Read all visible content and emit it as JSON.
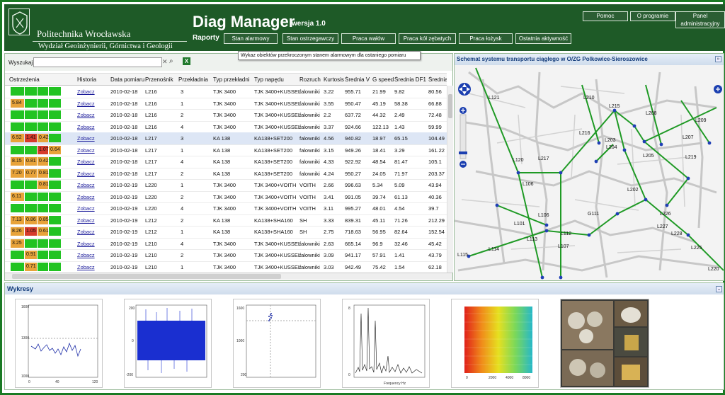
{
  "header": {
    "university": "Politechnika Wrocławska",
    "faculty": "Wydział Geoinżynierii, Górnictwa i Geologii",
    "app_title": "Diag Manager",
    "app_version": "wersja 1.0",
    "reports_label": "Raporty",
    "nav": [
      "Stan alarmowy",
      "Stan ostrzegawczy",
      "Praca wałów",
      "Praca kół zębatych",
      "Praca łożysk",
      "Ostatnia aktywność"
    ],
    "top_buttons": [
      "Pomoc",
      "O programie"
    ],
    "admin_panel": "Panel administracyjny"
  },
  "tooltip": "Wykaz obiektów przekroczonym stanem alarmowym dla ostaniego pomiaru",
  "search": {
    "label": "Wyszukaj",
    "value": "",
    "clear_icon": "✕",
    "search_icon": "⌕",
    "export_icon": "X"
  },
  "table": {
    "columns": [
      "Ostrzeżenia",
      "Historia",
      "Data pomiaru",
      "Przenośnik",
      "Przekładnia",
      "Typ przekładni",
      "Typ napędu",
      "Rozruch",
      "Kurtosis",
      "Średnia V",
      "G speed",
      "Średnia DF1",
      "Średnia DF3"
    ],
    "rows": [
      {
        "w": [
          "",
          "",
          "",
          ""
        ],
        "h": "Zobacz",
        "date": "2010-02-18",
        "p": "L216",
        "g": "3",
        "tp": "TJK 3400",
        "tn": "TJK 3400+KUSSEL",
        "r": "falowniki",
        "k": "3.22",
        "v": "955.71",
        "gs": "21.99",
        "df1": "9.82",
        "df3": "80.56"
      },
      {
        "w": [
          "5.84",
          "",
          "",
          ""
        ],
        "h": "Zobacz",
        "date": "2010-02-18",
        "p": "L216",
        "g": "1",
        "tp": "TJK 3400",
        "tn": "TJK 3400+KUSSEL",
        "r": "falowniki",
        "k": "3.55",
        "v": "950.47",
        "gs": "45.19",
        "df1": "58.38",
        "df3": "66.88"
      },
      {
        "w": [
          "",
          "",
          "",
          ""
        ],
        "h": "Zobacz",
        "date": "2010-02-18",
        "p": "L216",
        "g": "2",
        "tp": "TJK 3400",
        "tn": "TJK 3400+KUSSEL",
        "r": "falowniki",
        "k": "2.2",
        "v": "637.72",
        "gs": "44.32",
        "df1": "2.49",
        "df3": "72.48"
      },
      {
        "w": [
          "",
          "",
          "",
          ""
        ],
        "h": "Zobacz",
        "date": "2010-02-18",
        "p": "L216",
        "g": "4",
        "tp": "TJK 3400",
        "tn": "TJK 3400+KUSSEL",
        "r": "falowniki",
        "k": "3.37",
        "v": "924.66",
        "gs": "122.13",
        "df1": "1.43",
        "df3": "59.99"
      },
      {
        "w": [
          "6.52",
          "1.41",
          "0.42",
          ""
        ],
        "h": "Zobacz",
        "date": "2010-02-18",
        "p": "L217",
        "g": "3",
        "tp": "KA 138",
        "tn": "KA138+SET200",
        "r": "falowniki",
        "k": "4.56",
        "v": "940.82",
        "gs": "18.97",
        "df1": "65.15",
        "df3": "104.49"
      },
      {
        "w": [
          "",
          "",
          "1.07",
          "0.64"
        ],
        "h": "Zobacz",
        "date": "2010-02-18",
        "p": "L217",
        "g": "1",
        "tp": "KA 138",
        "tn": "KA138+SET200",
        "r": "falowniki",
        "k": "3.15",
        "v": "949.26",
        "gs": "18.41",
        "df1": "3.29",
        "df3": "161.22"
      },
      {
        "w": [
          "8.15",
          "0.81",
          "0.42",
          ""
        ],
        "h": "Zobacz",
        "date": "2010-02-18",
        "p": "L217",
        "g": "4",
        "tp": "KA 138",
        "tn": "KA138+SET200",
        "r": "falowniki",
        "k": "4.33",
        "v": "922.92",
        "gs": "48.54",
        "df1": "81.47",
        "df3": "105.1"
      },
      {
        "w": [
          "7.20",
          "0.77",
          "0.81",
          ""
        ],
        "h": "Zobacz",
        "date": "2010-02-18",
        "p": "L217",
        "g": "2",
        "tp": "KA 138",
        "tn": "KA138+SET200",
        "r": "falowniki",
        "k": "4.24",
        "v": "950.27",
        "gs": "24.05",
        "df1": "71.97",
        "df3": "203.37"
      },
      {
        "w": [
          "",
          "",
          "0.81",
          ""
        ],
        "h": "Zobacz",
        "date": "2010-02-19",
        "p": "L220",
        "g": "1",
        "tp": "TJK 3400",
        "tn": "TJK 3400+VOITH",
        "r": "VOITH",
        "k": "2.66",
        "v": "996.63",
        "gs": "5.34",
        "df1": "5.09",
        "df3": "43.94"
      },
      {
        "w": [
          "6.11",
          "",
          "",
          ""
        ],
        "h": "Zobacz",
        "date": "2010-02-19",
        "p": "L220",
        "g": "2",
        "tp": "TJK 3400",
        "tn": "TJK 3400+VOITH",
        "r": "VOITH",
        "k": "3.41",
        "v": "991.05",
        "gs": "39.74",
        "df1": "61.13",
        "df3": "40.36"
      },
      {
        "w": [
          "",
          "",
          "",
          ""
        ],
        "h": "Zobacz",
        "date": "2010-02-19",
        "p": "L220",
        "g": "4",
        "tp": "TJK 3400",
        "tn": "TJK 3400+VOITH",
        "r": "VOITH",
        "k": "3.11",
        "v": "995.27",
        "gs": "48.01",
        "df1": "4.54",
        "df3": "39.7"
      },
      {
        "w": [
          "7.13",
          "0.86",
          "0.85",
          ""
        ],
        "h": "Zobacz",
        "date": "2010-02-19",
        "p": "L212",
        "g": "2",
        "tp": "KA 138",
        "tn": "KA138+SHA160",
        "r": "SH",
        "k": "3.33",
        "v": "839.31",
        "gs": "45.11",
        "df1": "71.26",
        "df3": "212.29"
      },
      {
        "w": [
          "8.26",
          "1.05",
          "0.61",
          ""
        ],
        "h": "Zobacz",
        "date": "2010-02-19",
        "p": "L212",
        "g": "1",
        "tp": "KA 138",
        "tn": "KA138+SHA160",
        "r": "SH",
        "k": "2.75",
        "v": "718.63",
        "gs": "56.95",
        "df1": "82.64",
        "df3": "152.54"
      },
      {
        "w": [
          "3.25",
          "",
          "",
          ""
        ],
        "h": "Zobacz",
        "date": "2010-02-19",
        "p": "L210",
        "g": "4",
        "tp": "TJK 3400",
        "tn": "TJK 3400+KUSSEL",
        "r": "falowniki",
        "k": "2.63",
        "v": "665.14",
        "gs": "96.9",
        "df1": "32.46",
        "df3": "45.42"
      },
      {
        "w": [
          "",
          "0.91",
          "",
          ""
        ],
        "h": "Zobacz",
        "date": "2010-02-19",
        "p": "L210",
        "g": "2",
        "tp": "TJK 3400",
        "tn": "TJK 3400+KUSSEL",
        "r": "falowniki",
        "k": "3.09",
        "v": "941.17",
        "gs": "57.91",
        "df1": "1.41",
        "df3": "43.79"
      },
      {
        "w": [
          "",
          "0.71",
          "",
          ""
        ],
        "h": "Zobacz",
        "date": "2010-02-19",
        "p": "L210",
        "g": "1",
        "tp": "TJK 3400",
        "tn": "TJK 3400+KUSSEL",
        "r": "falowniki",
        "k": "3.03",
        "v": "942.49",
        "gs": "75.42",
        "df1": "1.54",
        "df3": "62.18"
      }
    ],
    "selected_row": 4
  },
  "map": {
    "title": "Schemat systemu transportu ciągłego w O/ZG Polkowice-Sieroszowice",
    "labels": [
      "L121",
      "L210",
      "L215",
      "L208",
      "L209",
      "L216",
      "L203",
      "L204",
      "L207",
      "L120",
      "L217",
      "L205",
      "L219",
      "L106",
      "L202",
      "L226",
      "L227",
      "L228",
      "L225",
      "L220",
      "L101",
      "L106",
      "G111",
      "L113",
      "L112",
      "L107",
      "L114",
      "L115"
    ]
  },
  "charts": {
    "title": "Wykresy",
    "thumbs": [
      "chart-time",
      "chart-signal",
      "chart-scatter",
      "chart-spectrum",
      "chart-heatmap",
      "photo-mosaic"
    ]
  },
  "colors": {
    "green": "#22c322",
    "orange": "#e8a33a",
    "red": "#d63b2b",
    "header": "#1e5a27"
  }
}
